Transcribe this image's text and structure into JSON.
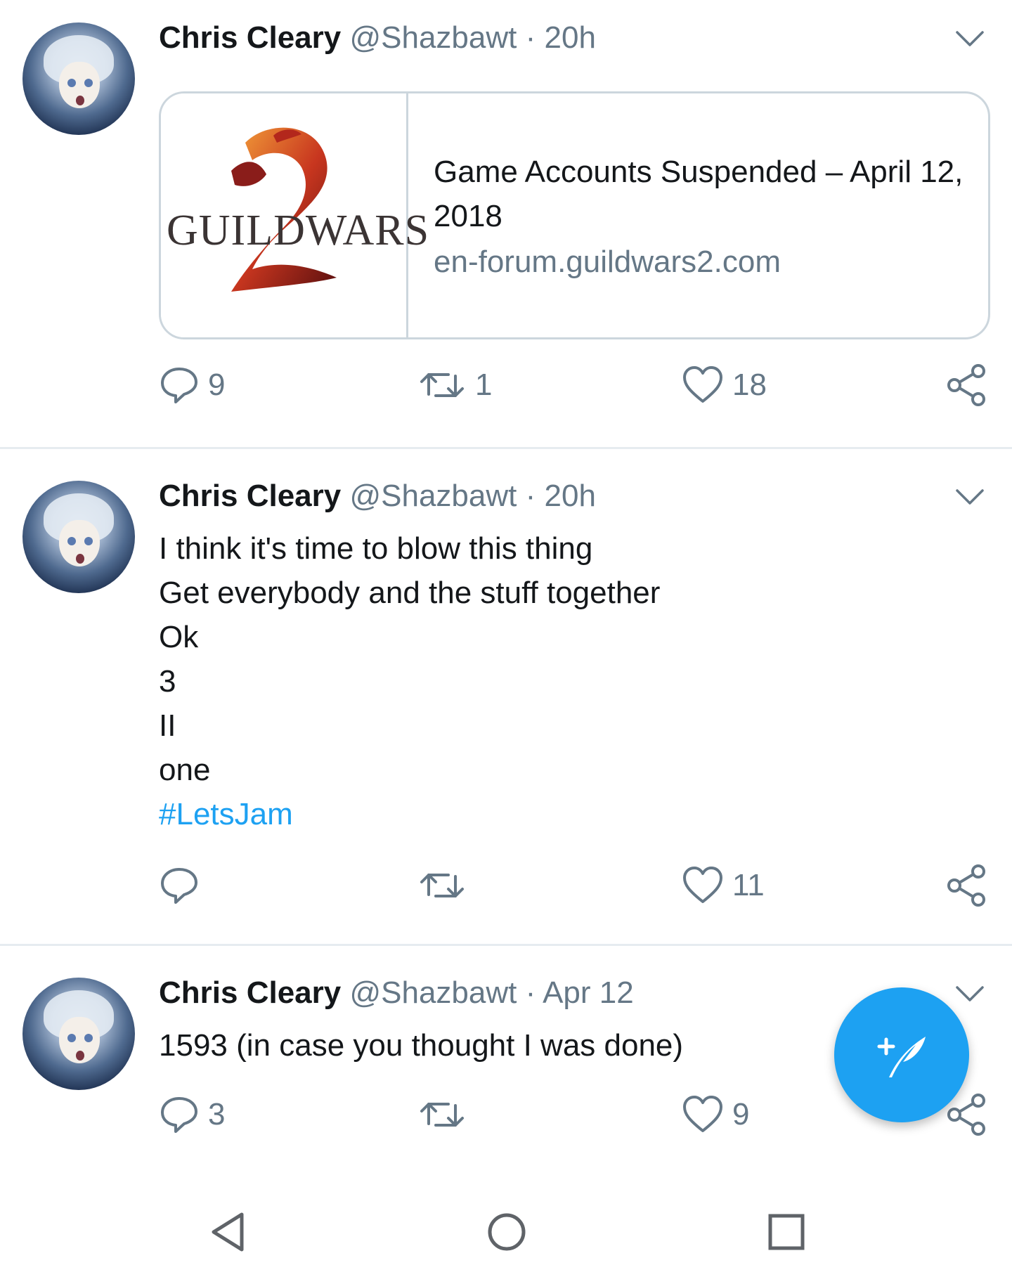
{
  "tweets": [
    {
      "name": "Chris Cleary",
      "handle": "@Shazbawt",
      "separator": "·",
      "time": "20h",
      "card": {
        "logo_text": "GUILDWARS",
        "title": "Game Accounts Suspended – April 12, 2018",
        "domain": "en-forum.guildwars2.com"
      },
      "actions": {
        "replies": "9",
        "retweets": "1",
        "likes": "18"
      }
    },
    {
      "name": "Chris Cleary",
      "handle": "@Shazbawt",
      "separator": "·",
      "time": "20h",
      "body_lines": [
        "I think it's time to blow this thing",
        "Get everybody and the stuff together",
        "Ok",
        "3",
        "II",
        "one"
      ],
      "hashtag": "#LetsJam",
      "actions": {
        "replies": "",
        "retweets": "",
        "likes": "11"
      }
    },
    {
      "name": "Chris Cleary",
      "handle": "@Shazbawt",
      "separator": "·",
      "time": "Apr 12",
      "body_lines": [
        "1593 (in case you thought I was done)"
      ],
      "actions": {
        "replies": "3",
        "retweets": "",
        "likes": "9"
      }
    }
  ],
  "icons": {
    "reply": "reply-icon",
    "retweet": "retweet-icon",
    "like": "heart-icon",
    "share": "share-icon",
    "more": "chevron-down-icon",
    "compose": "compose-tweet-icon",
    "nav_back": "back-triangle-icon",
    "nav_home": "home-circle-icon",
    "nav_recents": "recents-square-icon"
  },
  "colors": {
    "accent": "#1da1f2",
    "secondary_text": "#657786",
    "primary_text": "#14171a",
    "divider": "#e6ecf0"
  }
}
